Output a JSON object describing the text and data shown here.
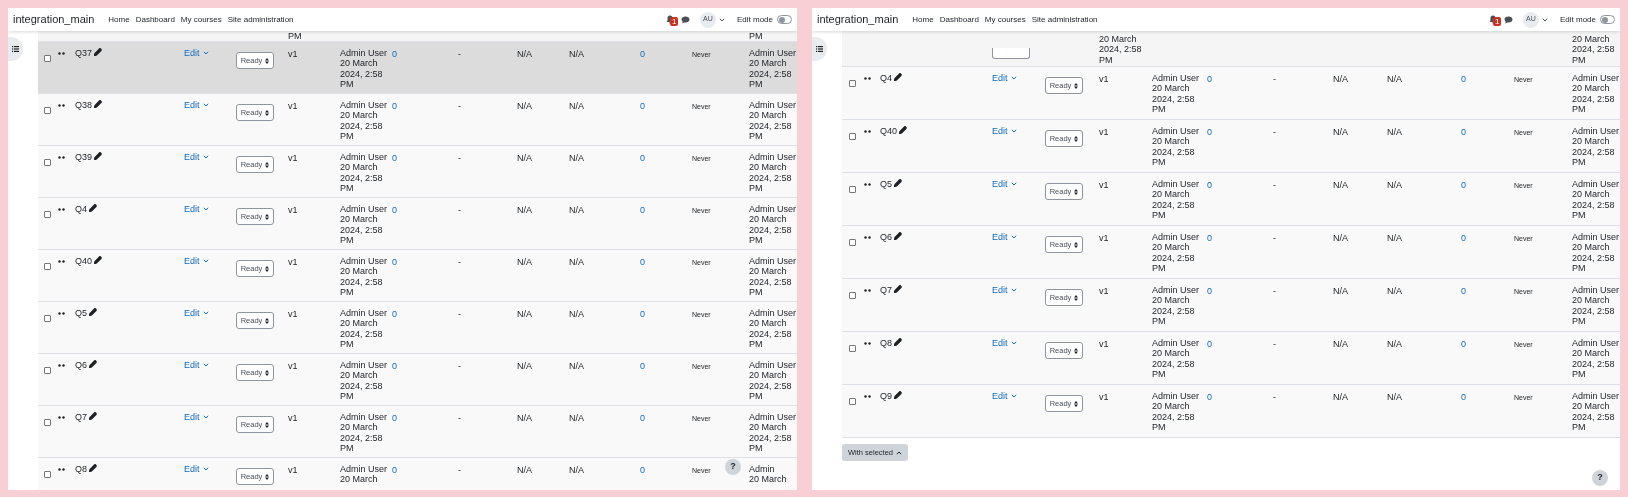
{
  "panels": [
    {
      "navbar": {
        "brand": "integration_main",
        "links": [
          "Home",
          "Dashboard",
          "My courses",
          "Site administration"
        ],
        "notification_count": "1",
        "avatar": "AU",
        "edit_mode_label": "Edit mode",
        "edit_mode_on": false
      },
      "top_partial": {
        "select_visible": false,
        "created": [
          "PM"
        ],
        "modified": [
          "PM"
        ]
      },
      "rows": [
        {
          "name": "Q37",
          "action": "Edit",
          "status": "Ready",
          "version": "v1",
          "created": [
            "Admin User",
            "20 March",
            "2024, 2:58",
            "PM"
          ],
          "column_8": "0",
          "column_9": "-",
          "column_10": "N/A",
          "column_11": "N/A",
          "column_12": "0",
          "column_13": "Never",
          "modified": [
            "Admin User",
            "20 March",
            "2024, 2:58",
            "PM"
          ],
          "checked": false,
          "highlighted": true
        },
        {
          "name": "Q38",
          "action": "Edit",
          "status": "Ready",
          "version": "v1",
          "created": [
            "Admin User",
            "20 March",
            "2024, 2:58",
            "PM"
          ],
          "column_8": "0",
          "column_9": "-",
          "column_10": "N/A",
          "column_11": "N/A",
          "column_12": "0",
          "column_13": "Never",
          "modified": [
            "Admin User",
            "20 March",
            "2024, 2:58",
            "PM"
          ],
          "checked": false,
          "highlighted": false
        },
        {
          "name": "Q39",
          "action": "Edit",
          "status": "Ready",
          "version": "v1",
          "created": [
            "Admin User",
            "20 March",
            "2024, 2:58",
            "PM"
          ],
          "column_8": "0",
          "column_9": "-",
          "column_10": "N/A",
          "column_11": "N/A",
          "column_12": "0",
          "column_13": "Never",
          "modified": [
            "Admin User",
            "20 March",
            "2024, 2:58",
            "PM"
          ],
          "checked": false,
          "highlighted": false
        },
        {
          "name": "Q4",
          "action": "Edit",
          "status": "Ready",
          "version": "v1",
          "created": [
            "Admin User",
            "20 March",
            "2024, 2:58",
            "PM"
          ],
          "column_8": "0",
          "column_9": "-",
          "column_10": "N/A",
          "column_11": "N/A",
          "column_12": "0",
          "column_13": "Never",
          "modified": [
            "Admin User",
            "20 March",
            "2024, 2:58",
            "PM"
          ],
          "checked": false,
          "highlighted": false
        },
        {
          "name": "Q40",
          "action": "Edit",
          "status": "Ready",
          "version": "v1",
          "created": [
            "Admin User",
            "20 March",
            "2024, 2:58",
            "PM"
          ],
          "column_8": "0",
          "column_9": "-",
          "column_10": "N/A",
          "column_11": "N/A",
          "column_12": "0",
          "column_13": "Never",
          "modified": [
            "Admin User",
            "20 March",
            "2024, 2:58",
            "PM"
          ],
          "checked": false,
          "highlighted": false
        },
        {
          "name": "Q5",
          "action": "Edit",
          "status": "Ready",
          "version": "v1",
          "created": [
            "Admin User",
            "20 March",
            "2024, 2:58",
            "PM"
          ],
          "column_8": "0",
          "column_9": "-",
          "column_10": "N/A",
          "column_11": "N/A",
          "column_12": "0",
          "column_13": "Never",
          "modified": [
            "Admin User",
            "20 March",
            "2024, 2:58",
            "PM"
          ],
          "checked": false,
          "highlighted": false
        },
        {
          "name": "Q6",
          "action": "Edit",
          "status": "Ready",
          "version": "v1",
          "created": [
            "Admin User",
            "20 March",
            "2024, 2:58",
            "PM"
          ],
          "column_8": "0",
          "column_9": "-",
          "column_10": "N/A",
          "column_11": "N/A",
          "column_12": "0",
          "column_13": "Never",
          "modified": [
            "Admin User",
            "20 March",
            "2024, 2:58",
            "PM"
          ],
          "checked": false,
          "highlighted": false
        },
        {
          "name": "Q7",
          "action": "Edit",
          "status": "Ready",
          "version": "v1",
          "created": [
            "Admin User",
            "20 March",
            "2024, 2:58",
            "PM"
          ],
          "column_8": "0",
          "column_9": "-",
          "column_10": "N/A",
          "column_11": "N/A",
          "column_12": "0",
          "column_13": "Never",
          "modified": [
            "Admin User",
            "20 March",
            "2024, 2:58",
            "PM"
          ],
          "checked": false,
          "highlighted": false
        },
        {
          "name": "Q8",
          "action": "Edit",
          "status": "Ready",
          "version": "v1",
          "created": [
            "Admin User",
            "20 March"
          ],
          "column_8": "0",
          "column_9": "-",
          "column_10": "N/A",
          "column_11": "N/A",
          "column_12": "0",
          "column_13": "Never",
          "modified": [
            "Admin",
            "20 March"
          ],
          "checked": false,
          "highlighted": false
        }
      ],
      "help": "?"
    },
    {
      "navbar": {
        "brand": "integration_main",
        "links": [
          "Home",
          "Dashboard",
          "My courses",
          "Site administration"
        ],
        "notification_count": "1",
        "avatar": "AU",
        "edit_mode_label": "Edit mode",
        "edit_mode_on": false
      },
      "top_partial": {
        "select_visible": true,
        "created": [
          "20 March",
          "2024, 2:58",
          "PM"
        ],
        "modified": [
          "20 March",
          "2024, 2:58",
          "PM"
        ]
      },
      "rows": [
        {
          "name": "Q4",
          "action": "Edit",
          "status": "Ready",
          "version": "v1",
          "created": [
            "Admin User",
            "20 March",
            "2024, 2:58",
            "PM"
          ],
          "column_8": "0",
          "column_9": "-",
          "column_10": "N/A",
          "column_11": "N/A",
          "column_12": "0",
          "column_13": "Never",
          "modified": [
            "Admin User",
            "20 March",
            "2024, 2:58",
            "PM"
          ],
          "checked": false,
          "highlighted": false
        },
        {
          "name": "Q40",
          "action": "Edit",
          "status": "Ready",
          "version": "v1",
          "created": [
            "Admin User",
            "20 March",
            "2024, 2:58",
            "PM"
          ],
          "column_8": "0",
          "column_9": "-",
          "column_10": "N/A",
          "column_11": "N/A",
          "column_12": "0",
          "column_13": "Never",
          "modified": [
            "Admin User",
            "20 March",
            "2024, 2:58",
            "PM"
          ],
          "checked": false,
          "highlighted": false
        },
        {
          "name": "Q5",
          "action": "Edit",
          "status": "Ready",
          "version": "v1",
          "created": [
            "Admin User",
            "20 March",
            "2024, 2:58",
            "PM"
          ],
          "column_8": "0",
          "column_9": "-",
          "column_10": "N/A",
          "column_11": "N/A",
          "column_12": "0",
          "column_13": "Never",
          "modified": [
            "Admin User",
            "20 March",
            "2024, 2:58",
            "PM"
          ],
          "checked": false,
          "highlighted": false
        },
        {
          "name": "Q6",
          "action": "Edit",
          "status": "Ready",
          "version": "v1",
          "created": [
            "Admin User",
            "20 March",
            "2024, 2:58",
            "PM"
          ],
          "column_8": "0",
          "column_9": "-",
          "column_10": "N/A",
          "column_11": "N/A",
          "column_12": "0",
          "column_13": "Never",
          "modified": [
            "Admin User",
            "20 March",
            "2024, 2:58",
            "PM"
          ],
          "checked": false,
          "highlighted": false
        },
        {
          "name": "Q7",
          "action": "Edit",
          "status": "Ready",
          "version": "v1",
          "created": [
            "Admin User",
            "20 March",
            "2024, 2:58",
            "PM"
          ],
          "column_8": "0",
          "column_9": "-",
          "column_10": "N/A",
          "column_11": "N/A",
          "column_12": "0",
          "column_13": "Never",
          "modified": [
            "Admin User",
            "20 March",
            "2024, 2:58",
            "PM"
          ],
          "checked": false,
          "highlighted": false
        },
        {
          "name": "Q8",
          "action": "Edit",
          "status": "Ready",
          "version": "v1",
          "created": [
            "Admin User",
            "20 March",
            "2024, 2:58",
            "PM"
          ],
          "column_8": "0",
          "column_9": "-",
          "column_10": "N/A",
          "column_11": "N/A",
          "column_12": "0",
          "column_13": "Never",
          "modified": [
            "Admin User",
            "20 March",
            "2024, 2:58",
            "PM"
          ],
          "checked": false,
          "highlighted": false
        },
        {
          "name": "Q9",
          "action": "Edit",
          "status": "Ready",
          "version": "v1",
          "created": [
            "Admin User",
            "20 March",
            "2024, 2:58",
            "PM"
          ],
          "column_8": "0",
          "column_9": "-",
          "column_10": "N/A",
          "column_11": "N/A",
          "column_12": "0",
          "column_13": "Never",
          "modified": [
            "Admin User",
            "20 March",
            "2024, 2:58",
            "PM"
          ],
          "checked": false,
          "highlighted": false
        }
      ],
      "with_selected": "With selected",
      "help": "?"
    }
  ]
}
